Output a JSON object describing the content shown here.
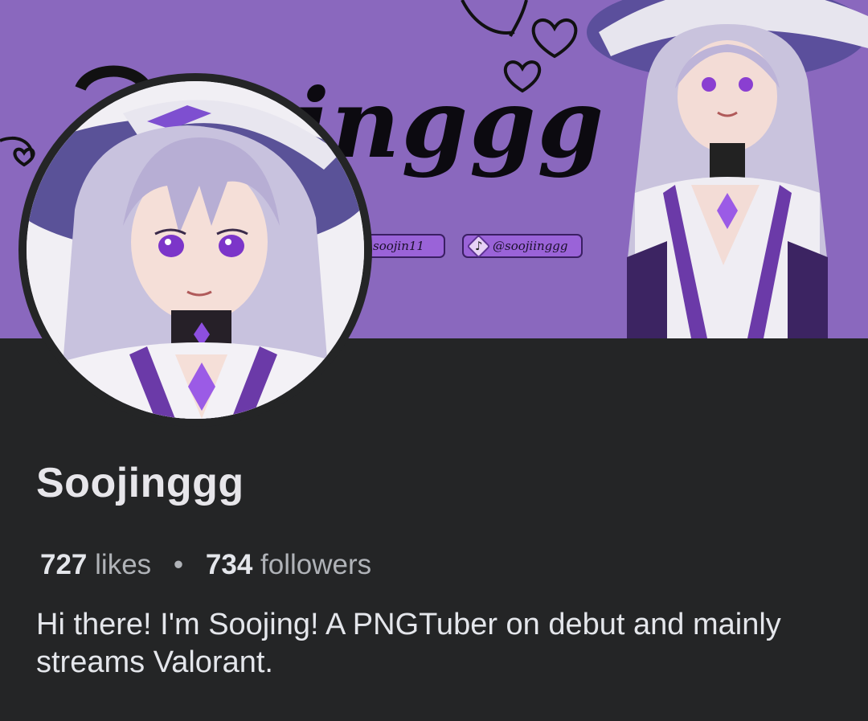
{
  "cover": {
    "title": "inggg",
    "social_links": [
      {
        "label": "soojin11"
      },
      {
        "label": "@soojiinggg",
        "icon": "tiktok-icon"
      }
    ]
  },
  "profile": {
    "name": "Soojinggg",
    "likes_count": "727",
    "likes_label": "likes",
    "separator": "•",
    "followers_count": "734",
    "followers_label": "followers",
    "bio": "Hi there! I'm Soojing! A PNGTuber on debut and mainly streams Valorant."
  },
  "colors": {
    "background": "#242526",
    "cover": "#8a68be",
    "accent_purple": "#9a63d8",
    "text_primary": "#e4e6eb",
    "text_secondary": "#b0b3b8"
  }
}
